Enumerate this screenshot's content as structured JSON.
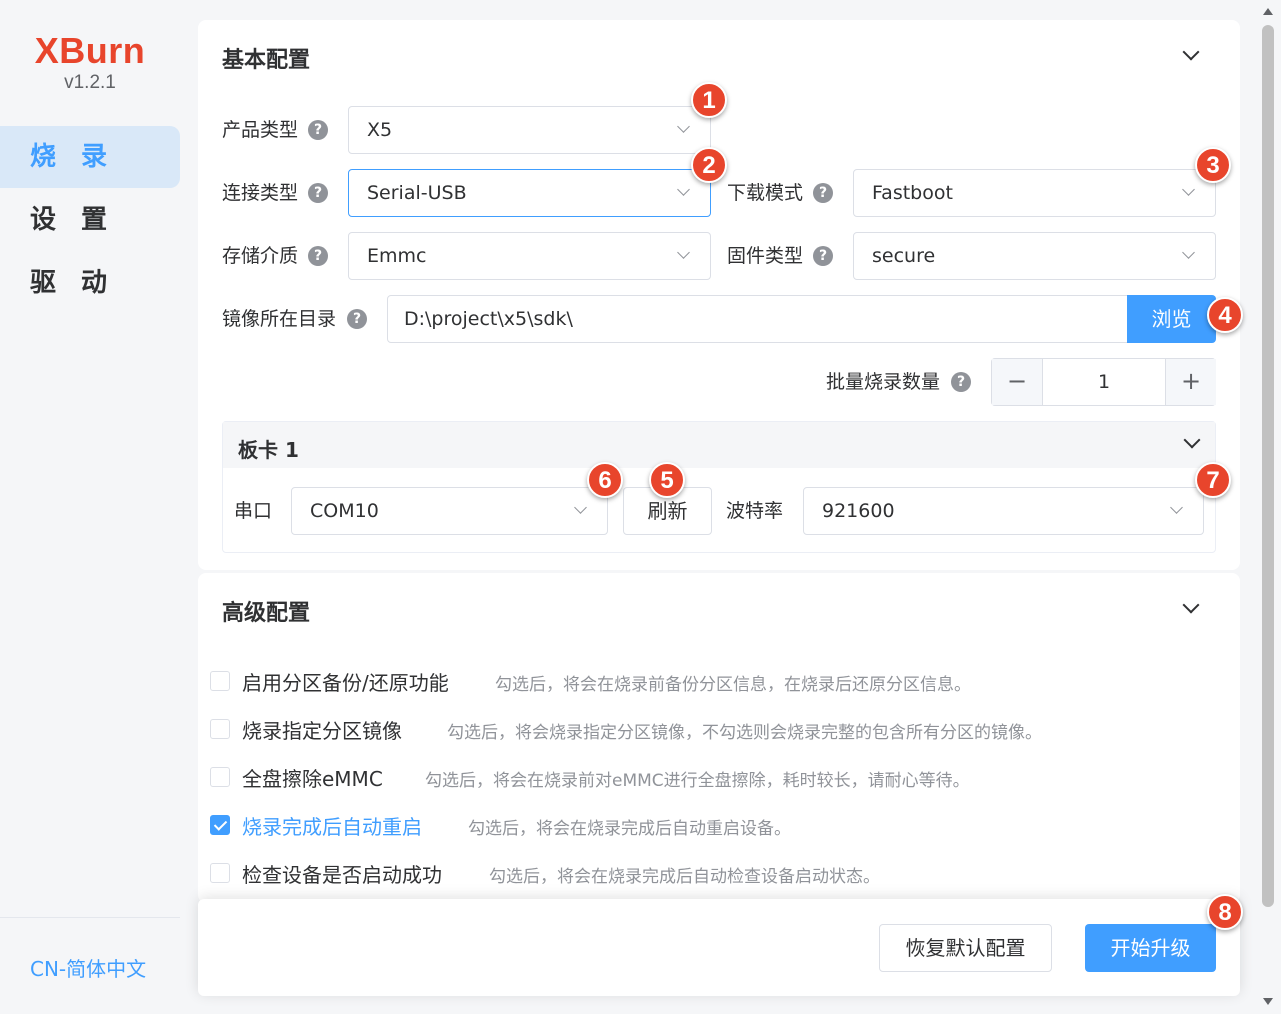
{
  "app": {
    "logo": "XBurn",
    "version": "v1.2.1"
  },
  "sidebar": {
    "items": [
      {
        "label": "烧 录",
        "active": true
      },
      {
        "label": "设 置",
        "active": false
      },
      {
        "label": "驱 动",
        "active": false
      }
    ],
    "language": "CN-简体中文"
  },
  "basic": {
    "title": "基本配置",
    "product_type": {
      "label": "产品类型",
      "value": "X5"
    },
    "connection_type": {
      "label": "连接类型",
      "value": "Serial-USB"
    },
    "download_mode": {
      "label": "下载模式",
      "value": "Fastboot"
    },
    "storage": {
      "label": "存储介质",
      "value": "Emmc"
    },
    "firmware_type": {
      "label": "固件类型",
      "value": "secure"
    },
    "image_dir": {
      "label": "镜像所在目录",
      "value": "D:\\project\\x5\\sdk\\",
      "browse_label": "浏览"
    },
    "batch": {
      "label": "批量烧录数量",
      "value": "1",
      "minus": "−",
      "plus": "+"
    },
    "board": {
      "title": "板卡 1",
      "port_label": "串口",
      "port_value": "COM10",
      "refresh_label": "刷新",
      "baud_label": "波特率",
      "baud_value": "921600"
    },
    "help_glyph": "?"
  },
  "advanced": {
    "title": "高级配置",
    "options": [
      {
        "name": "启用分区备份/还原功能",
        "desc": "勾选后，将会在烧录前备份分区信息，在烧录后还原分区信息。",
        "checked": false
      },
      {
        "name": "烧录指定分区镜像",
        "desc": "勾选后，将会烧录指定分区镜像，不勾选则会烧录完整的包含所有分区的镜像。",
        "checked": false
      },
      {
        "name": "全盘擦除eMMC",
        "desc": "勾选后，将会在烧录前对eMMC进行全盘擦除，耗时较长，请耐心等待。",
        "checked": false
      },
      {
        "name": "烧录完成后自动重启",
        "desc": "勾选后，将会在烧录完成后自动重启设备。",
        "checked": true
      },
      {
        "name": "检查设备是否启动成功",
        "desc": "勾选后，将会在烧录完成后自动检查设备启动状态。",
        "checked": false
      }
    ]
  },
  "footer": {
    "reset_label": "恢复默认配置",
    "start_label": "开始升级"
  },
  "annotations": [
    "1",
    "2",
    "3",
    "4",
    "5",
    "6",
    "7",
    "8"
  ],
  "colors": {
    "accent": "#409eff",
    "brand": "#e8452c",
    "badge": "#e8452c"
  }
}
